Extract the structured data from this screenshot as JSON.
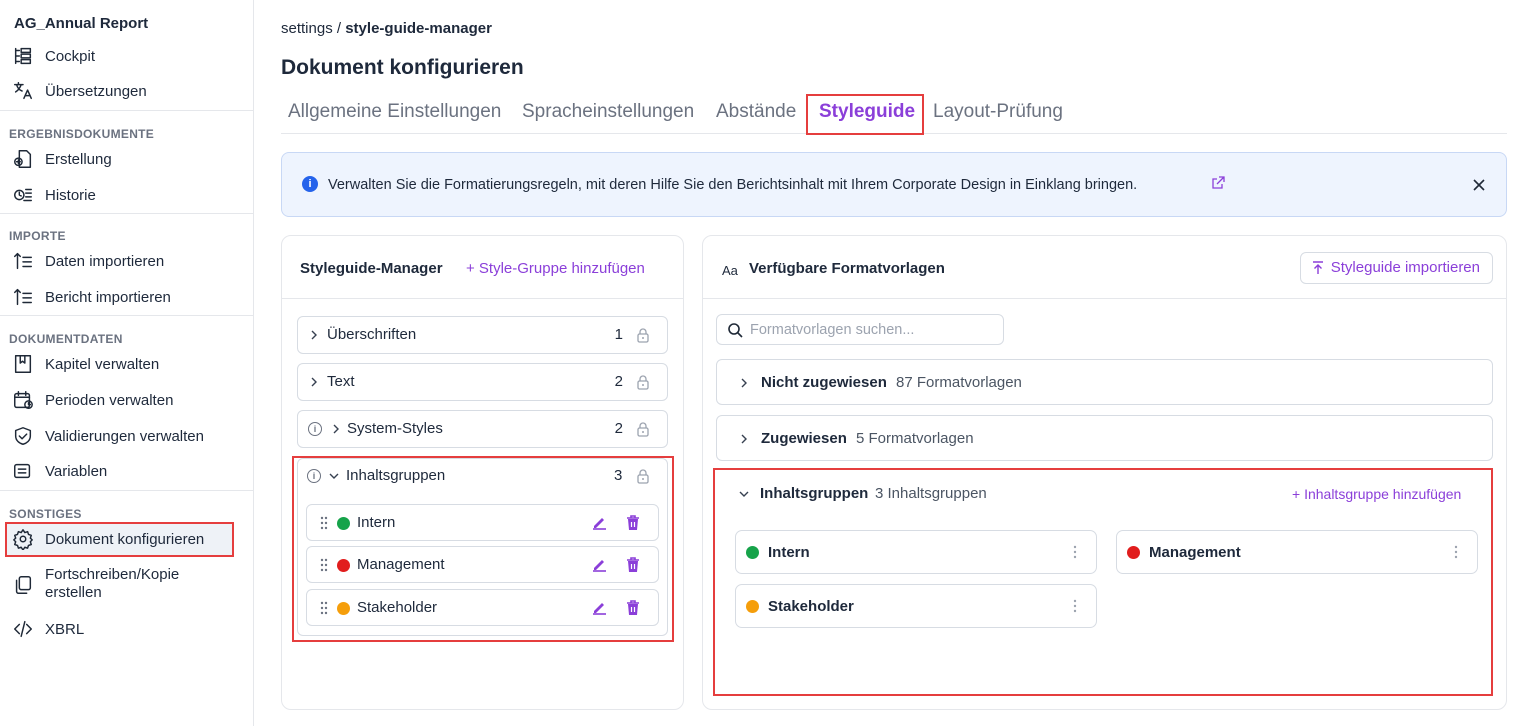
{
  "sidebar": {
    "app_title": "AG_Annual Report",
    "items_top": [
      {
        "label": "Cockpit",
        "icon": "hierarchy-icon"
      },
      {
        "label": "Übersetzungen",
        "icon": "translate-icon"
      }
    ],
    "sections": [
      {
        "label": "ERGEBNISDOKUMENTE",
        "items": [
          {
            "label": "Erstellung",
            "icon": "document-create-icon"
          },
          {
            "label": "Historie",
            "icon": "history-icon"
          }
        ]
      },
      {
        "label": "IMPORTE",
        "items": [
          {
            "label": "Daten importieren",
            "icon": "import-icon"
          },
          {
            "label": "Bericht importieren",
            "icon": "import-icon"
          }
        ]
      },
      {
        "label": "DOKUMENTDATEN",
        "items": [
          {
            "label": "Kapitel verwalten",
            "icon": "book-icon"
          },
          {
            "label": "Perioden verwalten",
            "icon": "calendar-icon"
          },
          {
            "label": "Validierungen verwalten",
            "icon": "shield-check-icon"
          },
          {
            "label": "Variablen",
            "icon": "list-icon"
          }
        ]
      },
      {
        "label": "SONSTIGES",
        "items": [
          {
            "label": "Dokument konfigurieren",
            "icon": "gear-icon"
          },
          {
            "label": "Fortschreiben/Kopie",
            "label2": "erstellen",
            "icon": "copy-icon"
          },
          {
            "label": "XBRL",
            "icon": "code-icon"
          }
        ]
      }
    ]
  },
  "breadcrumb": {
    "parent": "settings",
    "separator": " / ",
    "current": "style-guide-manager"
  },
  "page_title": "Dokument konfigurieren",
  "tabs": [
    "Allgemeine Einstellungen",
    "Spracheinstellungen",
    "Abstände",
    "Styleguide",
    "Layout-Prüfung"
  ],
  "active_tab": "Styleguide",
  "info_banner": {
    "text": "Verwalten Sie die Formatierungsregeln, mit deren Hilfe Sie den Berichtsinhalt mit Ihrem Corporate Design in Einklang bringen."
  },
  "styleguide_manager": {
    "title": "Styleguide-Manager",
    "add_label": "+ Style-Gruppe hinzufügen",
    "groups": [
      {
        "label": "Überschriften",
        "count": "1"
      },
      {
        "label": "Text",
        "count": "2"
      },
      {
        "label": "System-Styles",
        "count": "2"
      },
      {
        "label": "Inhaltsgruppen",
        "count": "3"
      }
    ],
    "content_groups": [
      {
        "label": "Intern",
        "color": "#16a34a"
      },
      {
        "label": "Management",
        "color": "#e11d1d"
      },
      {
        "label": "Stakeholder",
        "color": "#f59e0b"
      }
    ]
  },
  "formats": {
    "aa_glyph": "Aa",
    "title": "Verfügbare Formatvorlagen",
    "import_label": "Styleguide importieren",
    "search_placeholder": "Formatvorlagen suchen...",
    "accordions": [
      {
        "label": "Nicht zugewiesen",
        "sub": "87 Formatvorlagen"
      },
      {
        "label": "Zugewiesen",
        "sub": "5 Formatvorlagen"
      }
    ],
    "content_groups": {
      "label": "Inhaltsgruppen",
      "sub": "3 Inhaltsgruppen",
      "add_label": "+ Inhaltsgruppe hinzufügen",
      "cards": [
        {
          "label": "Intern",
          "color": "#16a34a"
        },
        {
          "label": "Management",
          "color": "#e11d1d"
        },
        {
          "label": "Stakeholder",
          "color": "#f59e0b"
        }
      ]
    }
  },
  "colors": {
    "accent": "#8b3fd9",
    "highlight": "#e53e3e",
    "info_bg": "#eef4fe"
  }
}
